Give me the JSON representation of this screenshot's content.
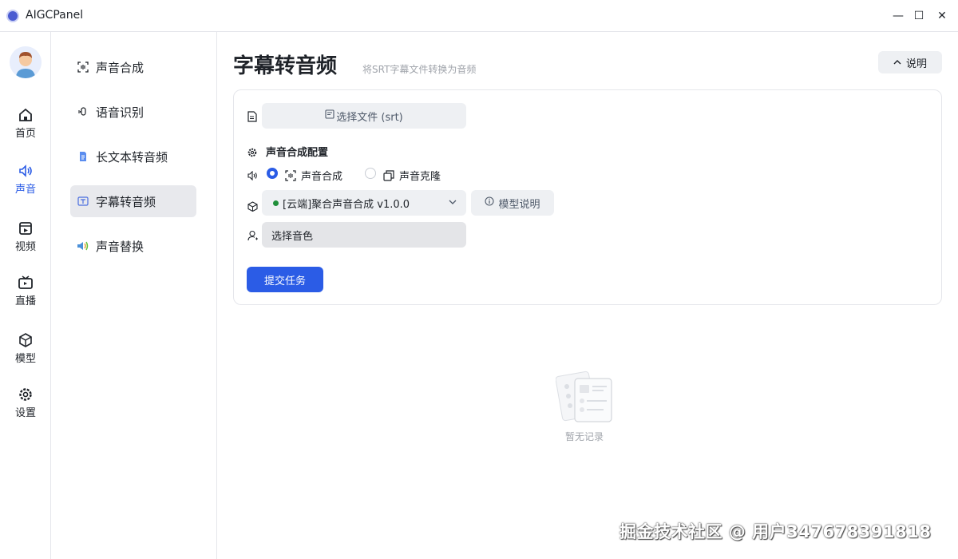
{
  "window": {
    "title": "AIGCPanel",
    "controls": {
      "minimize": "—",
      "maximize": "☐",
      "close": "✕"
    }
  },
  "rail": {
    "items": [
      {
        "label": "首页",
        "icon": "home-icon"
      },
      {
        "label": "声音",
        "icon": "speaker-icon",
        "active": true
      },
      {
        "label": "视频",
        "icon": "video-icon"
      },
      {
        "label": "直播",
        "icon": "tv-icon"
      },
      {
        "label": "模型",
        "icon": "cube-icon"
      },
      {
        "label": "设置",
        "icon": "gear-icon"
      }
    ]
  },
  "subnav": {
    "items": [
      {
        "label": "声音合成",
        "icon": "scan-icon"
      },
      {
        "label": "语音识别",
        "icon": "mic-icon"
      },
      {
        "label": "长文本转音频",
        "icon": "document-icon"
      },
      {
        "label": "字幕转音频",
        "icon": "subtitle-icon",
        "active": true
      },
      {
        "label": "声音替换",
        "icon": "sound-swap-icon"
      }
    ]
  },
  "main": {
    "title": "字幕转音频",
    "subtitle": "将SRT字幕文件转换为音频",
    "help_label": "说明"
  },
  "form": {
    "file_button_label": "选择文件 (srt)",
    "section_title": "声音合成配置",
    "radio_options": [
      {
        "label": "声音合成",
        "checked": true
      },
      {
        "label": "声音克隆",
        "checked": false
      }
    ],
    "model_select_value": "[云端]聚合声音合成 v1.0.0",
    "model_status_color": "#1f8f3a",
    "model_help_label": "模型说明",
    "voice_select_placeholder": "选择音色",
    "submit_label": "提交任务"
  },
  "empty_state": {
    "text": "暂无记录"
  },
  "watermark": "掘金技术社区 @ 用户347678391818",
  "colors": {
    "accent": "#2b5ce6",
    "active_bg": "#e8e9ed",
    "muted": "#a0a4ab"
  }
}
